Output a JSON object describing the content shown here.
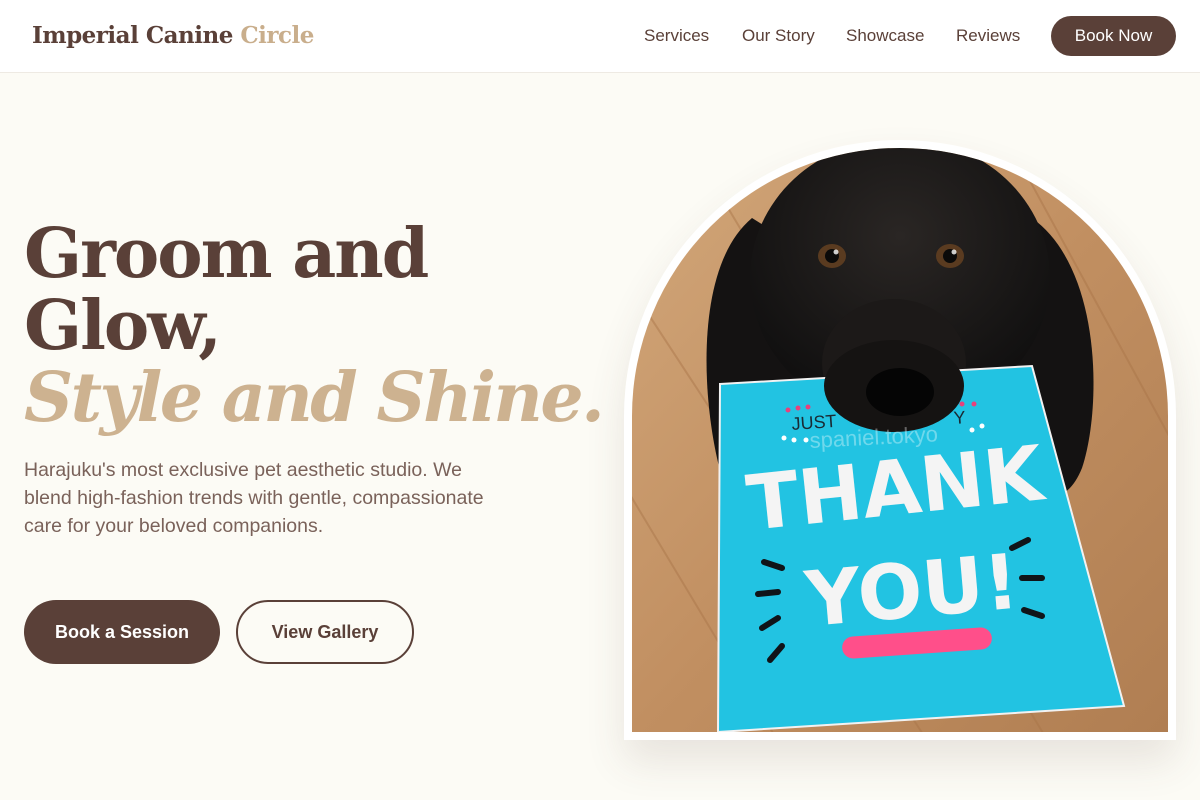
{
  "header": {
    "brand_main": "Imperial Canine",
    "brand_accent": "Circle",
    "nav": [
      "Services",
      "Our Story",
      "Showcase",
      "Reviews"
    ],
    "cta": "Book Now"
  },
  "hero": {
    "title_line1": "Groom and",
    "title_line2": "Glow,",
    "title_line3": "Style and Shine.",
    "description": "Harajuku's most exclusive pet aesthetic studio. We blend high-fashion trends with gentle, compassionate care for your beloved companions.",
    "primary_button": "Book a Session",
    "secondary_button": "View Gallery"
  },
  "photo": {
    "card_top_left": "JUST",
    "card_top_right": "Y",
    "card_line1": "THANK",
    "card_line2": "YOU!",
    "watermark": "spaniel.tokyo"
  },
  "colors": {
    "primary": "#5a4038",
    "accent": "#cdb290",
    "background": "#fcfbf5"
  }
}
